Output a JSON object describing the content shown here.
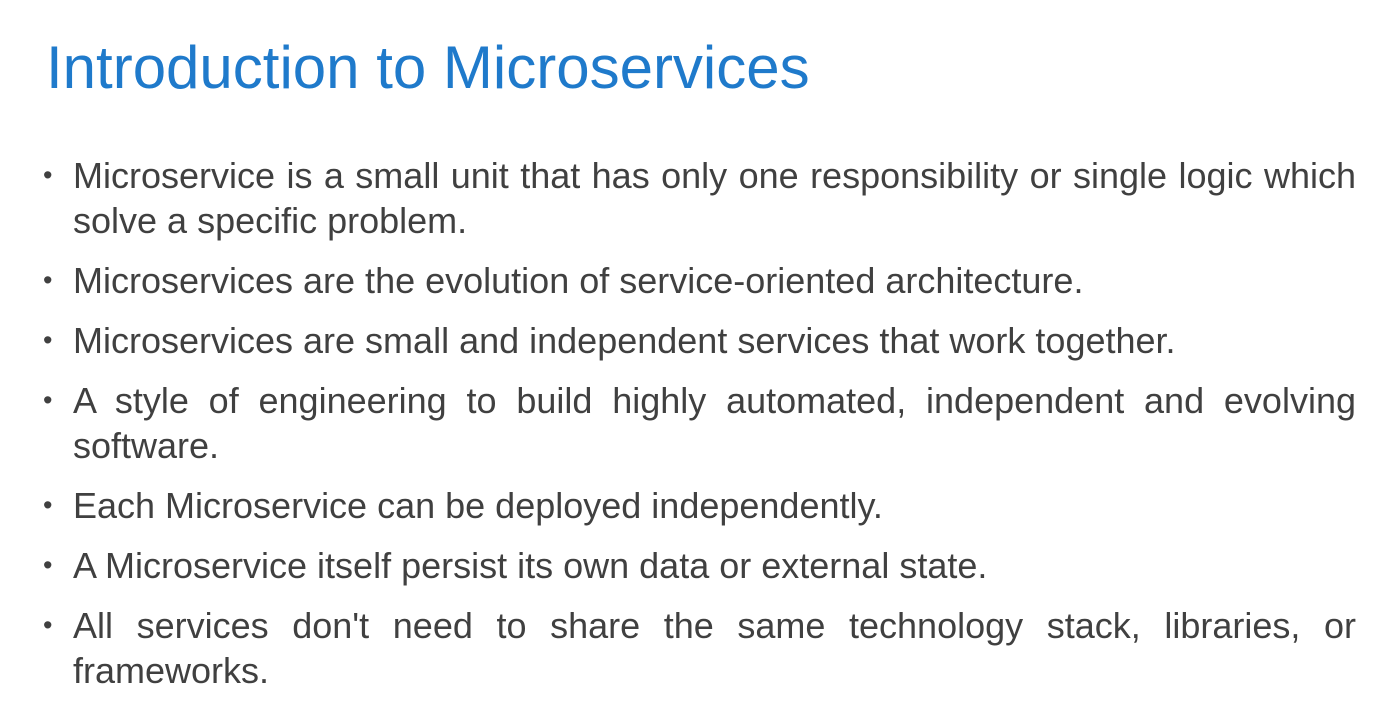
{
  "slide": {
    "title": "Introduction to Microservices",
    "bullets": [
      "Microservice is a small unit that has only one responsibility or single logic which solve a specific problem.",
      "Microservices are the evolution of service-oriented architecture.",
      "Microservices are small and independent services that work together.",
      "A style of engineering to build highly automated, independent and evolving software.",
      "Each Microservice can be deployed independently.",
      "A Microservice itself persist its own data or external state.",
      "All services don't need to share the same technology stack, libraries, or frameworks."
    ],
    "bullet_glyph": "•",
    "colors": {
      "title": "#1f7acb",
      "text": "#404040",
      "background": "#ffffff"
    }
  }
}
